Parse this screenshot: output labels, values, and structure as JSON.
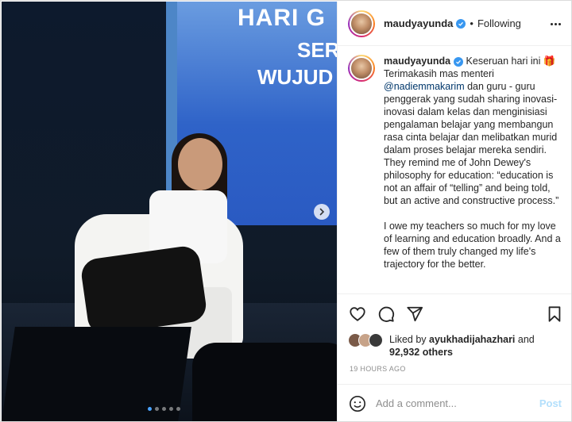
{
  "media": {
    "screen_line1": "HARI G",
    "screen_line2": "SER",
    "screen_line3": "WUJUD",
    "slide_count": 5,
    "active_slide": 1
  },
  "header": {
    "username": "maudyayunda",
    "separator": "•",
    "follow_status": "Following"
  },
  "caption": {
    "username": "maudyayunda",
    "line_intro": "Keseruan hari ini 🎁",
    "line_thanks": "Terimakasih mas menteri",
    "mention": "@nadiemmakarim",
    "text_after_mention": " dan guru - guru penggerak yang sudah sharing inovasi-inovasi dalam kelas dan menginisiasi pengalaman belajar yang membangun rasa cinta belajar dan melibatkan murid dalam proses belajar mereka sendiri. They remind me of John Dewey's philosophy for education: “education is not an affair of “telling” and being told, but an active and constructive process.”",
    "paragraph2": "I owe my teachers so much for my love of learning and education broadly. And a few of them truly changed my life's trajectory for the better."
  },
  "likes": {
    "prefix": "Liked by ",
    "liked_by_user": "ayukhadijahazhari",
    "conjunction": " and",
    "others_count": "92,932 others"
  },
  "timestamp": "19 HOURS AGO",
  "comment": {
    "placeholder": "Add a comment...",
    "post_label": "Post"
  },
  "colors": {
    "verified_blue": "#3897f0",
    "mention_blue": "#00376b",
    "post_disabled": "#b2dffc",
    "muted_gray": "#8e8e8e"
  },
  "icons": [
    "heart-icon",
    "comment-icon",
    "share-icon",
    "bookmark-icon",
    "emoji-icon",
    "more-icon",
    "verified-icon",
    "next-arrow-icon"
  ]
}
